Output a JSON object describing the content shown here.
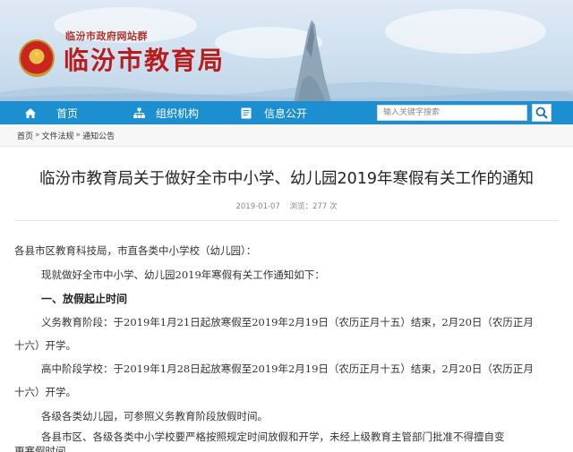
{
  "header": {
    "group_label": "临汾市政府网站群",
    "site_title": "临汾市教育局"
  },
  "nav": {
    "items": [
      {
        "label": "首页",
        "icon": "home-icon"
      },
      {
        "label": "组织机构",
        "icon": "org-chart-icon"
      },
      {
        "label": "信息公开",
        "icon": "document-icon"
      }
    ],
    "search_placeholder": "输入关键字搜索",
    "search_icon": "search-icon"
  },
  "breadcrumb": {
    "items": [
      "首页",
      "文件法规",
      "通知公告"
    ],
    "separator": "»"
  },
  "article": {
    "title": "临汾市教育局关于做好全市中小学、幼儿园2019年寒假有关工作的通知",
    "date": "2019-01-07",
    "views": "浏览：277 次",
    "paragraphs": [
      "各县市区教育科技局，市直各类中小学校（幼儿园）：",
      "现就做好全市中小学、幼儿园2019年寒假有关工作通知如下：",
      "一、放假起止时间",
      "义务教育阶段：于2019年1月21日起放寒假至2019年2月19日（农历正月十五）结束，2月20日（农历正月",
      "十六）开学。",
      "高中阶段学校：于2019年1月28日起放寒假至2019年2月19日（农历正月十五）结束，2月20日（农历正月",
      "十六）开学。",
      "各级各类幼儿园，可参照义务教育阶段放假时间。",
      "各县市区、各级各类中小学校要严格按照规定时间放假和开学，未经上级教育主管部门批准不得擅自变",
      "更寒假时间。"
    ]
  },
  "colors": {
    "nav_bg": "#1b8fd0",
    "title_red": "#b91c1c"
  }
}
